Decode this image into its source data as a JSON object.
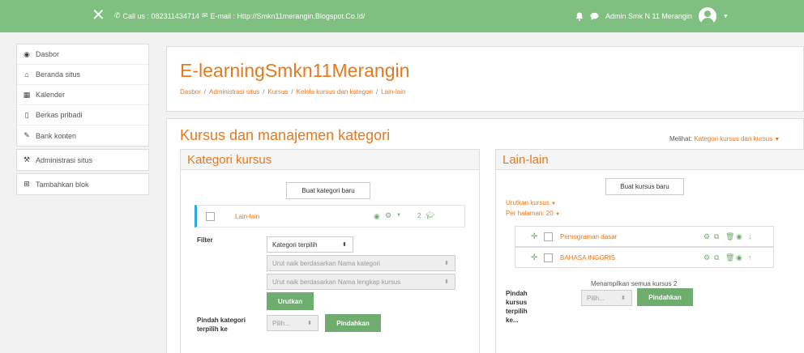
{
  "topbar": {
    "contact_text": "Call us : 082311434714",
    "email_text": "E-mail : Http://Smkn11merangin.Blogspot.Co.Id/",
    "user_name": "Admin Smk N 11 Merangin"
  },
  "sidebar": {
    "block1": [
      {
        "label": "Dasbor",
        "icon": "dashboard-icon"
      },
      {
        "label": "Beranda situs",
        "icon": "home-icon"
      },
      {
        "label": "Kalender",
        "icon": "calendar-icon"
      },
      {
        "label": "Berkas pribadi",
        "icon": "file-icon"
      },
      {
        "label": "Bank konten",
        "icon": "pencil-icon"
      }
    ],
    "block2": [
      {
        "label": "Administrasi situs",
        "icon": "wrench-icon"
      }
    ],
    "block3": [
      {
        "label": "Tambahkan blok",
        "icon": "plus-square-icon"
      }
    ]
  },
  "header": {
    "site_title": "E-learningSmkn11Merangin",
    "breadcrumb": [
      "Dasbor",
      "Administrasi situs",
      "Kursus",
      "Kelola kursus dan kategori",
      "Lain-lain"
    ]
  },
  "main": {
    "title": "Kursus dan manajemen kategori",
    "view_label": "Melihat:",
    "view_value": "Kategori kursus dan kursus"
  },
  "categories": {
    "heading": "Kategori kursus",
    "new_button": "Buat kategori baru",
    "row": {
      "name": "Lain-lain",
      "count": "2"
    },
    "filter_label": "Filter",
    "filter_select": "Kategori terpilih",
    "sort_select_1": "Urut naik berdasarkan Nama kategori",
    "sort_select_2": "Urut naik berdasarkan Nama lengkap kursus",
    "sort_button": "Urutkan",
    "move_label": "Pindah kategori terpilih ke",
    "move_select": "Pilih...",
    "move_button": "Pindahkan"
  },
  "courses": {
    "heading": "Lain-lain",
    "new_button": "Buat kursus baru",
    "sort_link": "Urutkan kursus",
    "per_page_link": "Per halaman: 20",
    "list": [
      {
        "name": "Pemograman dasar"
      },
      {
        "name": "BAHASA INGGRIS"
      }
    ],
    "showing_text": "Menampilkan semua kursus 2",
    "move_label": "Pindah kursus terpilih ke...",
    "move_select": "Pilih...",
    "move_button": "Pindahkan"
  },
  "colors": {
    "accent": "#e8781e",
    "topbar": "#7fbf7f",
    "button": "#6fad6f",
    "category_marker": "#29a9e0"
  }
}
